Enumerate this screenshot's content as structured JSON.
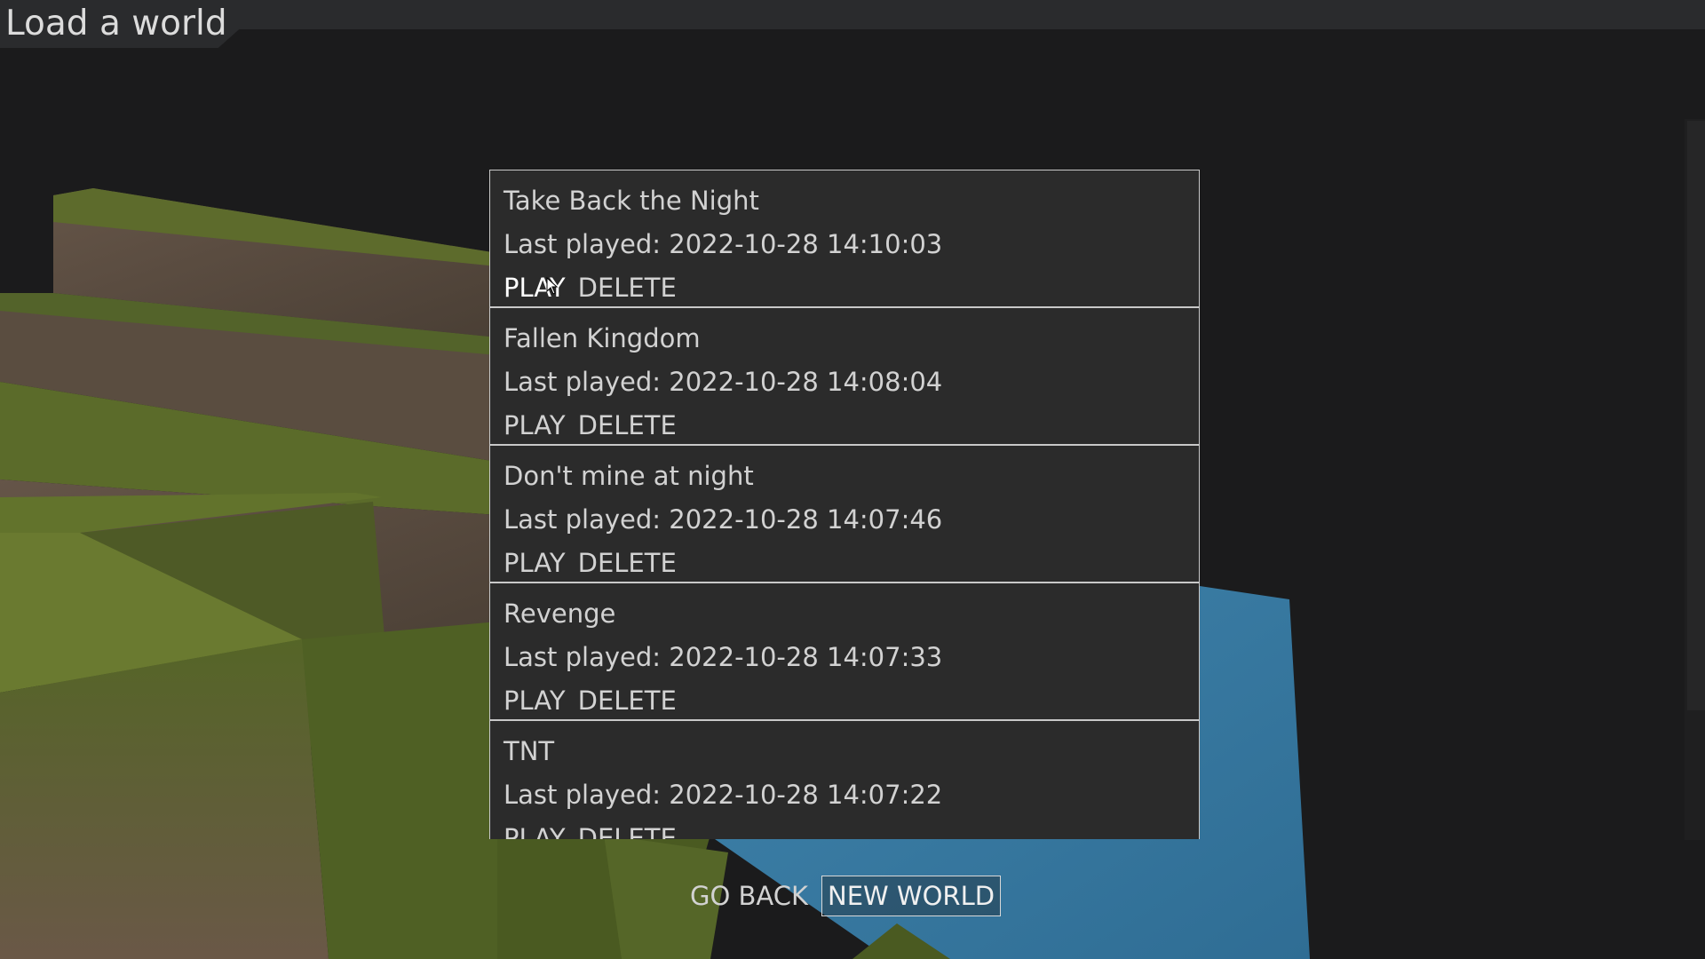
{
  "page": {
    "title": "Load a world"
  },
  "worlds": [
    {
      "name": "Take Back the Night",
      "last_played": "Last played: 2022-10-28 14:10:03",
      "play_label": "PLAY",
      "delete_label": "DELETE"
    },
    {
      "name": "Fallen Kingdom",
      "last_played": "Last played: 2022-10-28 14:08:04",
      "play_label": "PLAY",
      "delete_label": "DELETE"
    },
    {
      "name": "Don't mine at night",
      "last_played": "Last played: 2022-10-28 14:07:46",
      "play_label": "PLAY",
      "delete_label": "DELETE"
    },
    {
      "name": "Revenge",
      "last_played": "Last played: 2022-10-28 14:07:33",
      "play_label": "PLAY",
      "delete_label": "DELETE"
    },
    {
      "name": "TNT",
      "last_played": "Last played: 2022-10-28 14:07:22",
      "play_label": "PLAY",
      "delete_label": "DELETE"
    }
  ],
  "buttons": {
    "go_back": "GO BACK",
    "new_world": "NEW WORLD"
  },
  "colors": {
    "panel": "#2b2b2b",
    "border": "#c8c8c8",
    "text": "#d2d2d2",
    "water": "#3d7fa6",
    "grass": "#5a6a2c",
    "dirt": "#5a4c40"
  }
}
